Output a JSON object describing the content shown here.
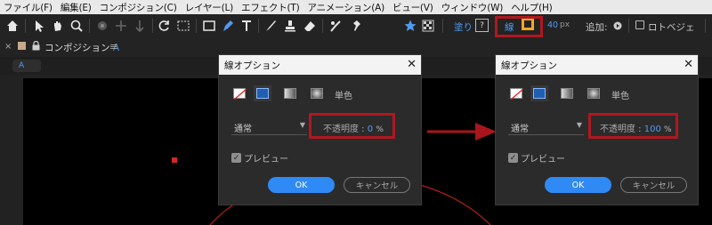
{
  "menu": [
    "ファイル(F)",
    "編集(E)",
    "コンポジション(C)",
    "レイヤー(L)",
    "エフェクト(T)",
    "アニメーション(A)",
    "ビュー(V)",
    "ウィンドウ(W)",
    "ヘルプ(H)"
  ],
  "toolbar": {
    "fill_label": "塗り",
    "fill_box": "?",
    "stroke_label": "線",
    "stroke_width": "40",
    "stroke_unit": "px",
    "add_label": "追加:",
    "roto_label": "ロトベジェ"
  },
  "panel": {
    "comp_label": "コンポジション",
    "comp_name": "A",
    "sub_tab": "A"
  },
  "dialog_left": {
    "title": "線オプション",
    "mono_label": "単色",
    "blend_mode": "通常",
    "opacity_label": "不透明度 :",
    "opacity_value": "0",
    "opacity_unit": "%",
    "preview_label": "プレビュー",
    "ok_label": "OK",
    "cancel_label": "キャンセル"
  },
  "dialog_right": {
    "title": "線オプション",
    "mono_label": "単色",
    "blend_mode": "通常",
    "opacity_label": "不透明度 :",
    "opacity_value": "100",
    "opacity_unit": "%",
    "preview_label": "プレビュー",
    "ok_label": "OK",
    "cancel_label": "キャンセル"
  },
  "colors": {
    "accent": "#2f8af5",
    "highlight": "#b0171f",
    "stroke_swatch": "#f5a623",
    "circle_stroke": "#b02020"
  },
  "icons": [
    "home-icon",
    "selection-tool-icon",
    "hand-tool-icon",
    "zoom-tool-icon",
    "rotate-tool-icon",
    "camera-tool-icon",
    "anchor-tool-icon",
    "rectangle-tool-icon",
    "pen-tool-icon",
    "text-tool-icon",
    "brush-tool-icon",
    "clone-stamp-icon",
    "eraser-icon",
    "roto-brush-icon",
    "puppet-pin-icon",
    "star-icon",
    "checker-icon"
  ]
}
